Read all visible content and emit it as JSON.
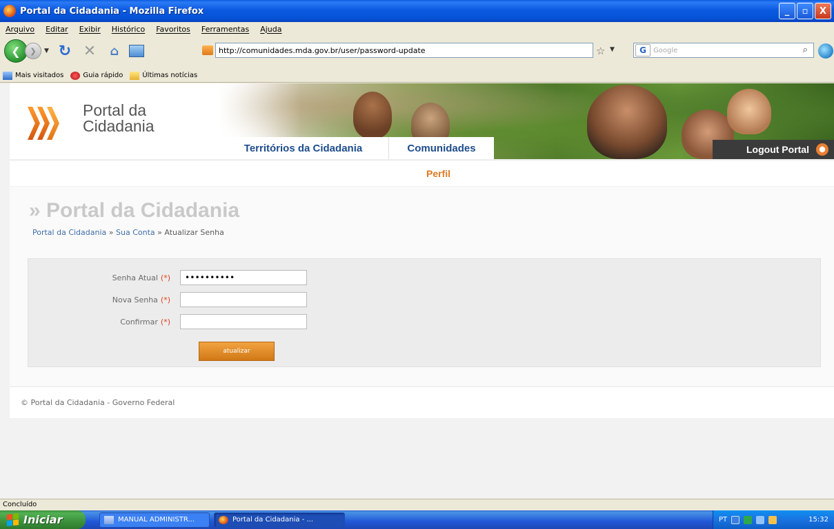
{
  "window": {
    "title": "Portal da Cidadania - Mozilla Firefox",
    "buttons": [
      "_",
      "▫",
      "X"
    ]
  },
  "menu": [
    "Arquivo",
    "Editar",
    "Exibir",
    "Histórico",
    "Favoritos",
    "Ferramentas",
    "Ajuda"
  ],
  "nav": {
    "url": "http://comunidades.mda.gov.br/user/password-update",
    "search_placeholder": "Google"
  },
  "bookmarks": [
    {
      "label": "Mais visitados",
      "icon": "folder-icon"
    },
    {
      "label": "Guia rápido",
      "icon": "guide-icon"
    },
    {
      "label": "Últimas notícias",
      "icon": "rss-icon"
    }
  ],
  "site": {
    "logo_text": "Portal da Cidadania",
    "logo_line1": "Portal da",
    "logo_line2": "Cidadania",
    "tabs": [
      "Territórios da Cidadania",
      "Comunidades"
    ],
    "logout": "Logout Portal",
    "subnav": "Perfil",
    "page_title": "» Portal da Cidadania",
    "breadcrumb": {
      "items": [
        "Portal da Cidadania",
        "Sua Conta"
      ],
      "current": "Atualizar Senha",
      "sep": " » "
    },
    "form": {
      "current_password_label": "Senha Atual",
      "current_password_value": "••••••••••",
      "new_password_label": "Nova Senha",
      "confirm_label": "Confirmar",
      "required_mark": "(*)",
      "submit_label": "atualizar"
    },
    "footer": "© Portal da Cidadania - Governo Federal"
  },
  "status": "Concluído",
  "taskbar": {
    "start_label": "Iniciar",
    "tasks": [
      "MANUAL ADMINISTR...",
      "Portal da Cidadania - ..."
    ],
    "lang": "PT",
    "clock": "15:32"
  },
  "colors": {
    "accent_orange": "#e07a1f",
    "link_blue": "#1e4d8c",
    "xp_blue": "#0a5be0"
  }
}
